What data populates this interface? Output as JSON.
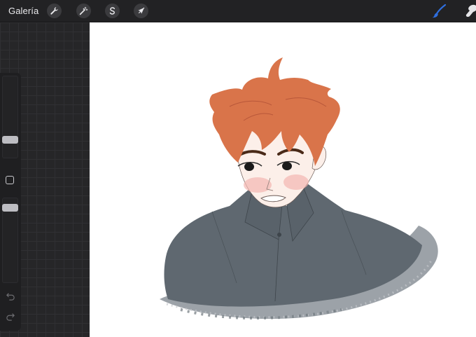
{
  "toolbar": {
    "gallery_label": "Galería",
    "left_tools": [
      {
        "name": "actions",
        "icon": "wrench-icon"
      },
      {
        "name": "adjustments",
        "icon": "magic-wand-icon"
      },
      {
        "name": "selection",
        "icon": "selection-s-icon"
      },
      {
        "name": "transform",
        "icon": "arrow-cursor-icon"
      }
    ],
    "right_tools": [
      {
        "name": "brush",
        "icon": "brush-icon",
        "active": true
      },
      {
        "name": "smudge",
        "icon": "smudge-icon",
        "active": false
      }
    ]
  },
  "sidebar": {
    "brush_size_level": 0.2,
    "opacity_level": 0.92,
    "modify_icon": "square-icon",
    "undo_icon": "undo-icon",
    "redo_icon": "redo-icon"
  },
  "canvas": {
    "content": "illustration",
    "colors": {
      "hair": "#d9744a",
      "shirt": "#5f6870",
      "skin": "#fcefe9",
      "accent": "#2f6fe0"
    }
  }
}
